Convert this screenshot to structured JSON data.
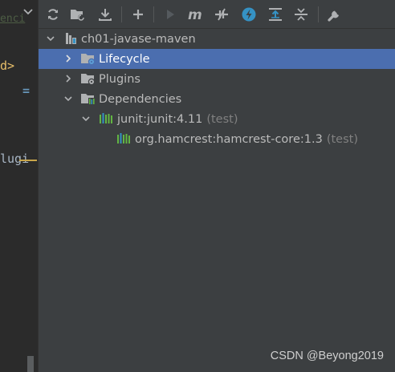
{
  "editor": {
    "fragment_top": "enci",
    "fragment_1": "d>",
    "fragment_eq": "=",
    "fragment_2": "lugi"
  },
  "toolbar": {
    "buttons": [
      {
        "name": "reimport-icon"
      },
      {
        "name": "generate-sources-icon"
      },
      {
        "name": "download-sources-icon"
      },
      {
        "name": "add-maven-project-icon"
      },
      {
        "name": "run-icon"
      },
      {
        "name": "execute-goal-icon"
      },
      {
        "name": "toggle-offline-icon"
      },
      {
        "name": "skip-tests-icon"
      },
      {
        "name": "show-dependencies-icon"
      },
      {
        "name": "collapse-all-icon"
      },
      {
        "name": "settings-icon"
      }
    ]
  },
  "tree": {
    "project": "ch01-javase-maven",
    "lifecycle": "Lifecycle",
    "plugins": "Plugins",
    "dependencies": "Dependencies",
    "dep1": {
      "coord": "junit:junit:4.11",
      "scope": "(test)"
    },
    "dep2": {
      "coord": "org.hamcrest:hamcrest-core:1.3",
      "scope": "(test)"
    }
  },
  "colors": {
    "selection": "#4b6eaf",
    "panel_bg": "#3c3f41",
    "editor_bg": "#2b2b2b",
    "accent_blue": "#3592c4"
  },
  "watermark": "CSDN @Beyong2019"
}
